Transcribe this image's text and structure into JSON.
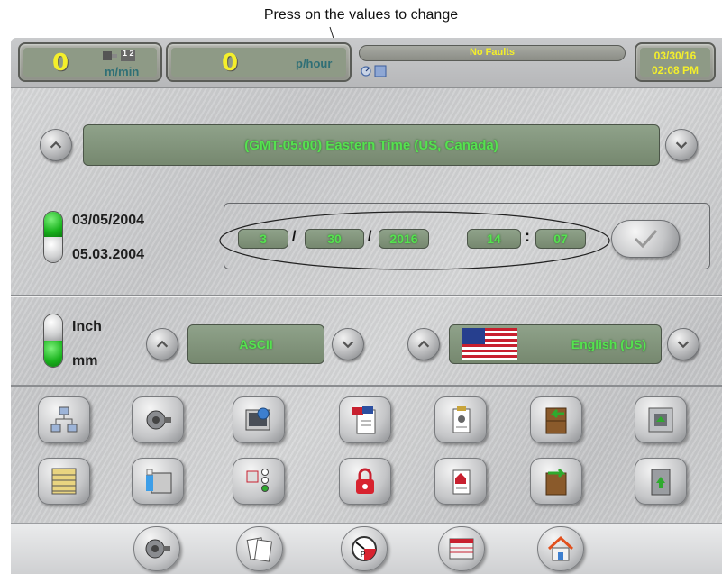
{
  "callout_text": "Press on the values to change",
  "top": {
    "speed_value": "0",
    "speed_unit": "m/min",
    "speed_mode": "1 2",
    "rate_value": "0",
    "rate_unit": "p/hour",
    "fault_text": "No Faults",
    "status_small": "0:",
    "date": "03/30/16",
    "time": "02:08 PM"
  },
  "timezone": {
    "label": "(GMT-05:00) Eastern Time (US, Canada)"
  },
  "date_format": {
    "option_1": "03/05/2004",
    "option_2": "05.03.2004",
    "selected": "option_1"
  },
  "datetime": {
    "month": "3",
    "day": "30",
    "year": "2016",
    "sep_date": "/",
    "hour": "14",
    "minute": "07",
    "sep_time": ":"
  },
  "units": {
    "option_1": "Inch",
    "option_2": "mm",
    "selected": "option_2"
  },
  "charset": {
    "label": "ASCII"
  },
  "language": {
    "label": "English (US)"
  },
  "colors": {
    "green_text": "#55e24f",
    "lcd_yellow": "#f4ef2b",
    "accent_green": "#18b21c"
  },
  "icons_row1": [
    "network-diagram-icon",
    "motor-icon",
    "monitor-globe-icon",
    "clipboard-flags-icon",
    "clipboard-wrench-icon",
    "cabinet-import-icon",
    "panel-upload-icon"
  ],
  "icons_row2": [
    "list-table-icon",
    "screen-clean-icon",
    "io-indicators-icon",
    "lock-icon",
    "clipboard-house-icon",
    "cabinet-export-icon",
    "door-upload-icon"
  ],
  "bottom_icons": [
    "motor-icon",
    "documents-icon",
    "gauge-icon",
    "table-icon",
    "home-icon"
  ]
}
